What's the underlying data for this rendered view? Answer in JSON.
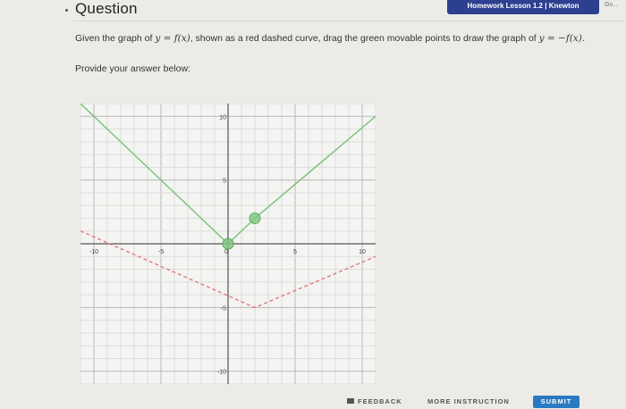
{
  "header": {
    "tab_label": "Homework Lesson 1.2 | Knewton",
    "right_fragment": "Gv..."
  },
  "question": {
    "title": "Question",
    "prompt_start": "Given the graph of ",
    "prompt_fx1": "y = f(x)",
    "prompt_mid": ", shown as a red dashed curve, drag the green movable points to draw the graph of ",
    "prompt_fx2": "y = −f(x)",
    "prompt_end": ".",
    "answer_label": "Provide your answer below:"
  },
  "chart_data": {
    "type": "line",
    "x_range": [
      -11,
      11
    ],
    "y_range": [
      -11,
      11
    ],
    "grid": true,
    "tick_labels_x": [
      "-10",
      "-5",
      "0",
      "5",
      "10"
    ],
    "tick_labels_y": [
      "10",
      "5",
      "-5",
      "-10"
    ],
    "series": [
      {
        "style": "dashed",
        "color": "#e07a7a",
        "points": [
          [
            -11,
            1
          ],
          [
            2,
            -5
          ],
          [
            11,
            -1
          ]
        ]
      },
      {
        "style": "solid",
        "color": "#78c07a",
        "points": [
          [
            -11,
            11
          ],
          [
            0,
            0
          ],
          [
            2,
            2
          ],
          [
            11,
            10
          ]
        ]
      }
    ],
    "movable_points": [
      [
        0,
        0
      ],
      [
        2,
        2
      ]
    ]
  },
  "footer": {
    "feedback_label": "FEEDBACK",
    "more_label": "MORE INSTRUCTION",
    "submit_label": "SUBMIT"
  }
}
